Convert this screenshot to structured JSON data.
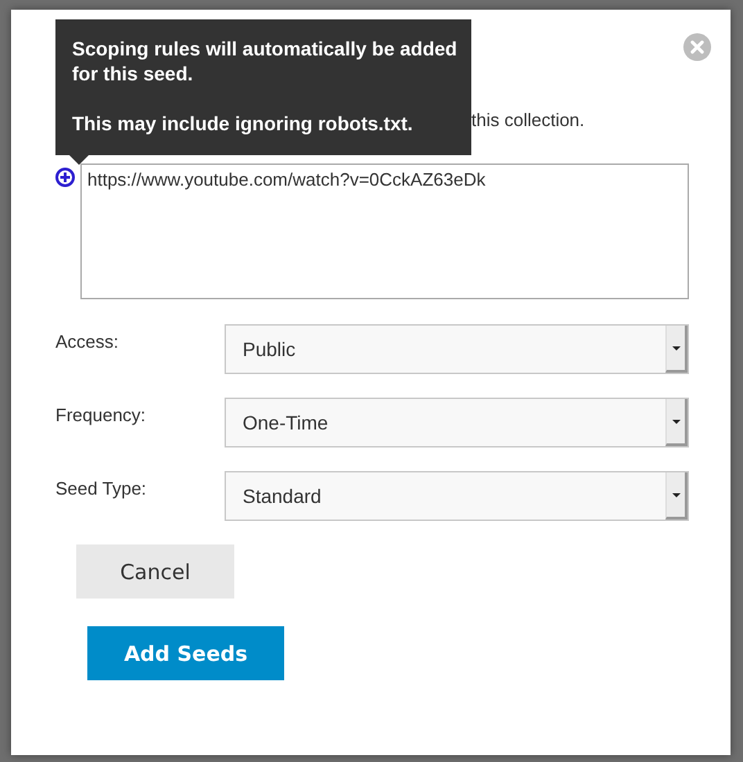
{
  "tooltip": {
    "paragraphs": [
      "Scoping rules will automatically be added for this seed.",
      "This may include ignoring robots.txt."
    ]
  },
  "intro": "this collection.",
  "seeds_field": {
    "value": "https://www.youtube.com/watch?v=0CckAZ63eDk"
  },
  "fields": [
    {
      "label": "Access:",
      "value": "Public"
    },
    {
      "label": "Frequency:",
      "value": "One-Time"
    },
    {
      "label": "Seed Type:",
      "value": "Standard"
    }
  ],
  "buttons": [
    {
      "label": "Cancel",
      "kind": "secondary"
    },
    {
      "label": "Add Seeds",
      "kind": "primary"
    }
  ]
}
